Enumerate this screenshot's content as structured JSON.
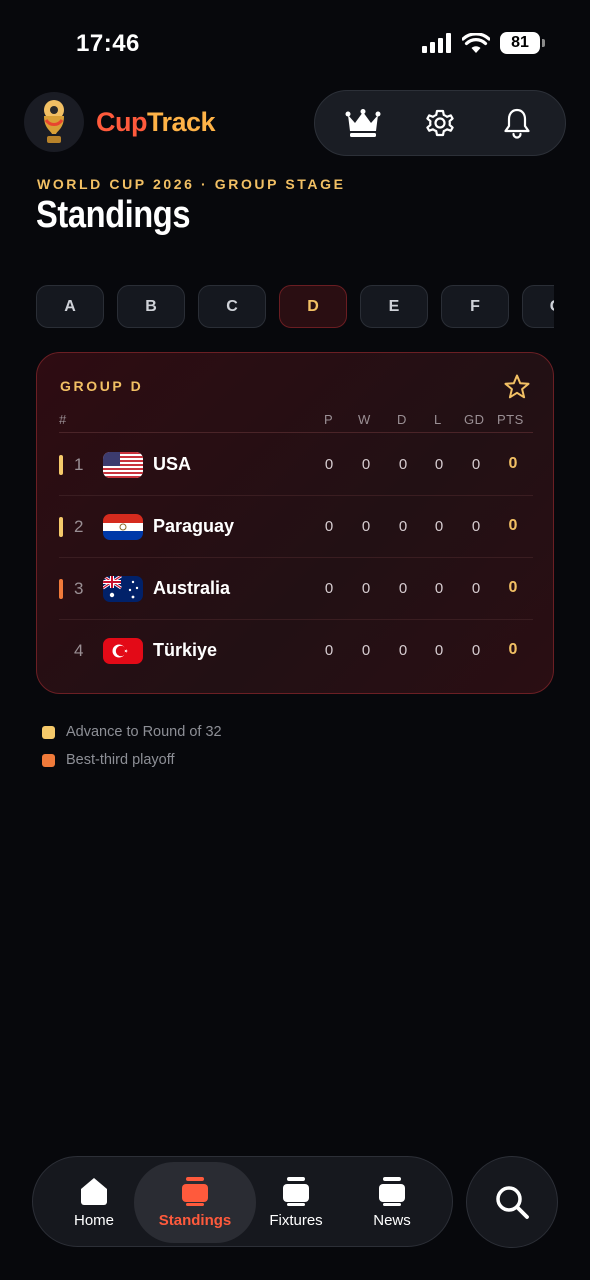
{
  "status_bar": {
    "time": "17:46",
    "battery": "81"
  },
  "app": {
    "name_part1": "Cup",
    "name_part2": "Track"
  },
  "header": {
    "eyebrow": "WORLD CUP 2026 · GROUP STAGE",
    "title": "Standings"
  },
  "group_tabs": [
    {
      "label": "A",
      "active": false
    },
    {
      "label": "B",
      "active": false
    },
    {
      "label": "C",
      "active": false
    },
    {
      "label": "D",
      "active": true
    },
    {
      "label": "E",
      "active": false
    },
    {
      "label": "F",
      "active": false
    },
    {
      "label": "G",
      "active": false
    }
  ],
  "card": {
    "title": "GROUP D",
    "columns": {
      "pos": "#",
      "p": "P",
      "w": "W",
      "d": "D",
      "l": "L",
      "gd": "GD",
      "pts": "PTS"
    },
    "rows": [
      {
        "pos": "1",
        "team": "USA",
        "flag": "usa-flag",
        "qual": "advance",
        "p": "0",
        "w": "0",
        "d": "0",
        "l": "0",
        "gd": "0",
        "pts": "0"
      },
      {
        "pos": "2",
        "team": "Paraguay",
        "flag": "paraguay-flag",
        "qual": "advance",
        "p": "0",
        "w": "0",
        "d": "0",
        "l": "0",
        "gd": "0",
        "pts": "0"
      },
      {
        "pos": "3",
        "team": "Australia",
        "flag": "australia-flag",
        "qual": "best-third",
        "p": "0",
        "w": "0",
        "d": "0",
        "l": "0",
        "gd": "0",
        "pts": "0"
      },
      {
        "pos": "4",
        "team": "Türkiye",
        "flag": "turkiye-flag",
        "qual": "none",
        "p": "0",
        "w": "0",
        "d": "0",
        "l": "0",
        "gd": "0",
        "pts": "0"
      }
    ]
  },
  "legend": [
    {
      "label": "Advance to Round of 32",
      "color": "#f5c96a"
    },
    {
      "label": "Best-third playoff",
      "color": "#f07a3a"
    }
  ],
  "nav": {
    "items": [
      {
        "label": "Home",
        "icon": "home-icon",
        "active": false
      },
      {
        "label": "Standings",
        "icon": "standings-icon",
        "active": true
      },
      {
        "label": "Fixtures",
        "icon": "fixtures-icon",
        "active": false
      },
      {
        "label": "News",
        "icon": "news-icon",
        "active": false
      }
    ]
  },
  "colors": {
    "accent_gold": "#f2c064",
    "accent_red": "#ff5a3c",
    "advance": "#f5c96a",
    "best_third": "#f07a3a"
  }
}
